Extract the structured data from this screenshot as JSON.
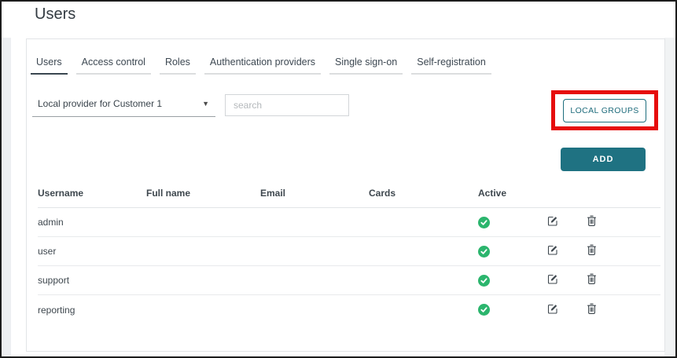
{
  "page": {
    "title": "Users"
  },
  "tabs": [
    {
      "label": "Users",
      "active": true
    },
    {
      "label": "Access control",
      "active": false
    },
    {
      "label": "Roles",
      "active": false
    },
    {
      "label": "Authentication providers",
      "active": false
    },
    {
      "label": "Single sign-on",
      "active": false
    },
    {
      "label": "Self-registration",
      "active": false
    }
  ],
  "filters": {
    "provider_selected": "Local provider for Customer 1",
    "search_placeholder": "search"
  },
  "buttons": {
    "local_groups": "LOCAL GROUPS",
    "add": "ADD"
  },
  "table": {
    "columns": [
      "Username",
      "Full name",
      "Email",
      "Cards",
      "Active"
    ],
    "rows": [
      {
        "username": "admin",
        "full_name": "",
        "email": "",
        "cards": "",
        "active": true
      },
      {
        "username": "user",
        "full_name": "",
        "email": "",
        "cards": "",
        "active": true
      },
      {
        "username": "support",
        "full_name": "",
        "email": "",
        "cards": "",
        "active": true
      },
      {
        "username": "reporting",
        "full_name": "",
        "email": "",
        "cards": "",
        "active": true
      }
    ]
  },
  "colors": {
    "accent_teal": "#1f7282",
    "highlight_red": "#e60d0d",
    "active_green": "#2bb56d"
  }
}
